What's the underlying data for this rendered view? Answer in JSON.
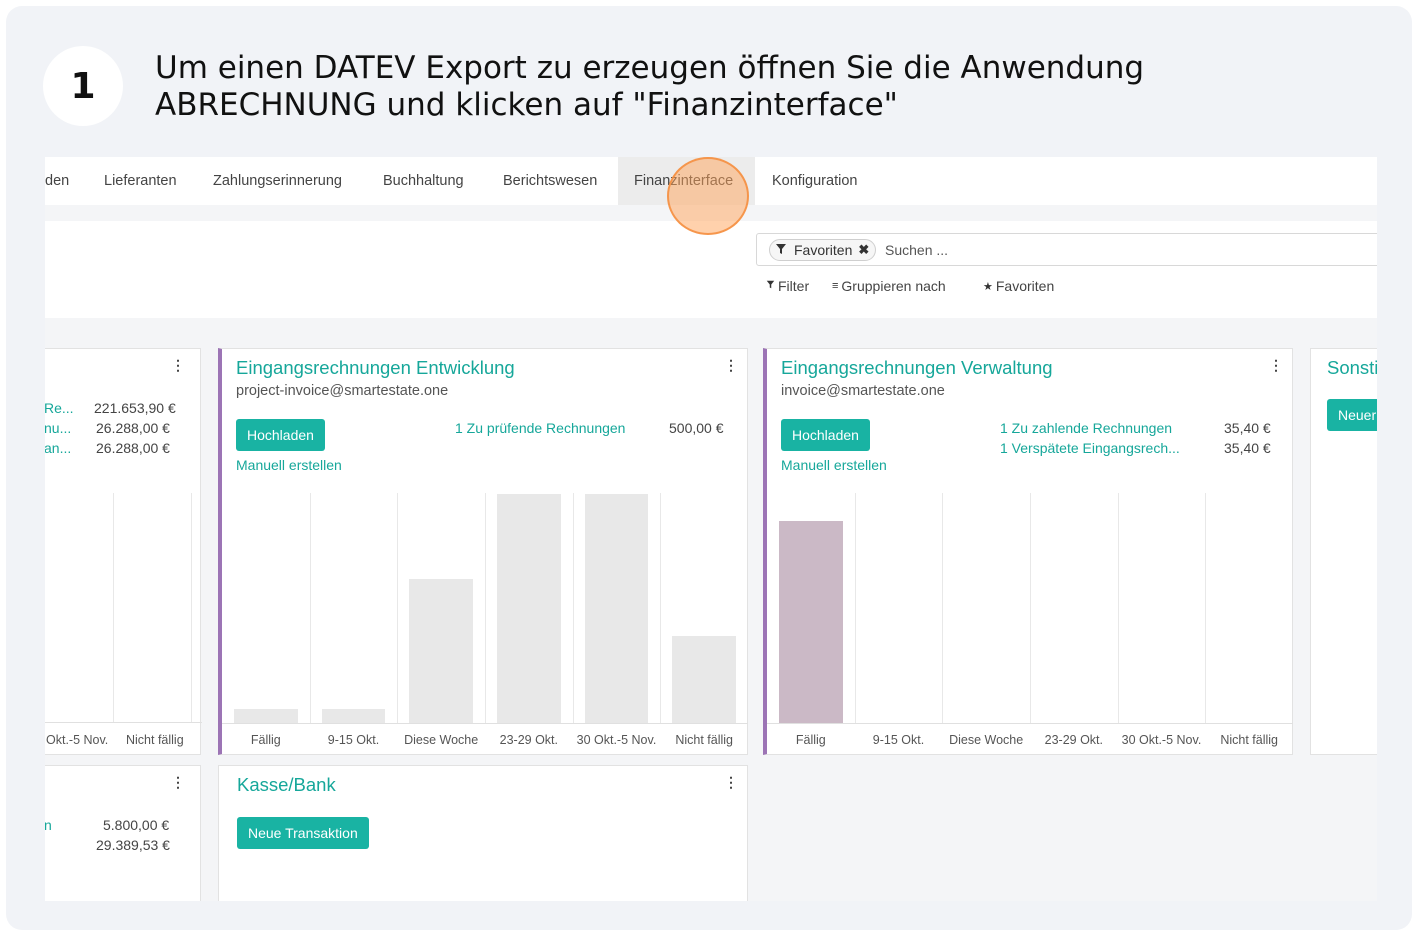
{
  "step": {
    "number": "1",
    "text": "Um einen DATEV Export zu erzeugen öffnen Sie die Anwendung ABRECHNUNG und klicken auf \"Finanzinterface\""
  },
  "menu": {
    "items": [
      {
        "label": "den"
      },
      {
        "label": "Lieferanten"
      },
      {
        "label": "Zahlungserinnerung"
      },
      {
        "label": "Buchhaltung"
      },
      {
        "label": "Berichtswesen"
      },
      {
        "label": "Finanzinterface"
      },
      {
        "label": "Konfiguration"
      }
    ],
    "active": "Finanzinterface"
  },
  "search": {
    "facet_label": "Favoriten",
    "placeholder": "Suchen ..."
  },
  "options": {
    "filter": "Filter",
    "group_by": "Gruppieren nach",
    "favorites": "Favoriten"
  },
  "cards": {
    "left_partial": {
      "rows": [
        {
          "label": "Re...",
          "amount": "221.653,90 €"
        },
        {
          "label": "nu...",
          "amount": "26.288,00 €"
        },
        {
          "label": "an...",
          "amount": "26.288,00 €"
        }
      ],
      "graph_labels": [
        "Okt.-5 Nov.",
        "Nicht fällig"
      ]
    },
    "development": {
      "title": "Eingangsrechnungen Entwicklung",
      "email": "project-invoice@smartestate.one",
      "upload": "Hochladen",
      "manual": "Manuell erstellen",
      "stat_label": "1 Zu prüfende Rechnungen",
      "stat_amount": "500,00 €",
      "graph_labels": [
        "Fällig",
        "9-15 Okt.",
        "Diese Woche",
        "23-29 Okt.",
        "30 Okt.-5 Nov.",
        "Nicht fällig"
      ],
      "bar_levels": [
        0.06,
        0.06,
        0.63,
        1.0,
        1.0,
        0.38
      ]
    },
    "administration": {
      "title": "Eingangsrechnungen Verwaltung",
      "email": "invoice@smartestate.one",
      "upload": "Hochladen",
      "manual": "Manuell erstellen",
      "stat1_label": "1 Zu zahlende Rechnungen",
      "stat1_amount": "35,40 €",
      "stat2_label": "1 Verspätete Eingangsrech...",
      "stat2_amount": "35,40 €",
      "graph_labels": [
        "Fällig",
        "9-15 Okt.",
        "Diese Woche",
        "23-29 Okt.",
        "30 Okt.-5 Nov.",
        "Nicht fällig"
      ],
      "bar_levels": [
        0.88,
        0,
        0,
        0,
        0,
        0
      ]
    },
    "other_partial": {
      "title": "Sonsti",
      "button": "Neuer"
    },
    "left_bottom_partial": {
      "rows": [
        {
          "label": "n",
          "amount": "5.800,00 €"
        },
        {
          "label": "",
          "amount": "29.389,53 €"
        }
      ]
    },
    "cash": {
      "title": "Kasse/Bank",
      "button": "Neue Transaktion"
    }
  },
  "colors": {
    "accent": "#19b3a3",
    "card_border_purple": "#9c74b5",
    "bar_gray": "#e8e8e8",
    "bar_purple": "#cbb9c6",
    "highlight": "#f7a35c"
  }
}
